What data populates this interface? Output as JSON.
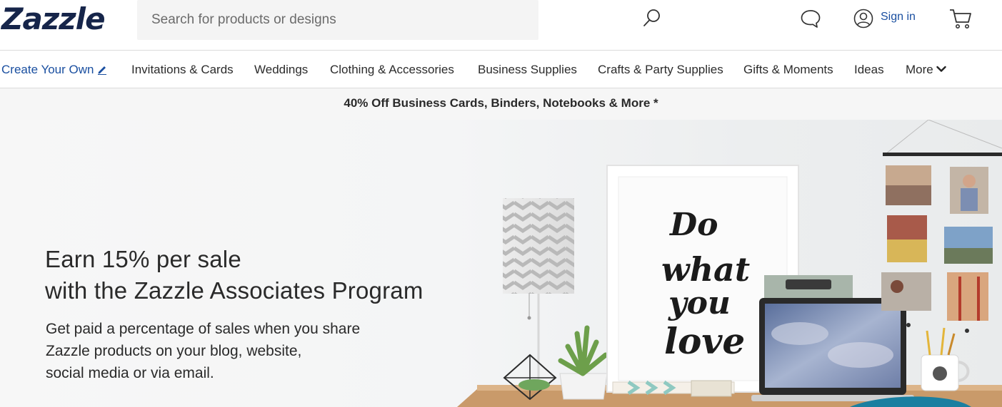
{
  "brand": {
    "logo_text": "Zazzle",
    "logo_color": "#16254a",
    "link_color": "#1a4fa0"
  },
  "search": {
    "placeholder": "Search for products or designs",
    "value": ""
  },
  "header": {
    "sign_in_label": "Sign in",
    "icons": [
      "search-icon",
      "chat-icon",
      "account-icon",
      "cart-icon"
    ]
  },
  "nav": {
    "items": [
      {
        "label": "Create Your Own"
      },
      {
        "label": "Invitations & Cards"
      },
      {
        "label": "Weddings"
      },
      {
        "label": "Clothing & Accessories"
      },
      {
        "label": "Business Supplies"
      },
      {
        "label": "Crafts & Party Supplies"
      },
      {
        "label": "Gifts & Moments"
      },
      {
        "label": "Ideas"
      },
      {
        "label": "More"
      }
    ]
  },
  "promo": {
    "text": "40% Off Business Cards, Binders, Notebooks & More *"
  },
  "hero": {
    "title_line1": "Earn 15% per sale",
    "title_line2": "with the Zazzle Associates Program",
    "body_line1": "Get paid a percentage of sales when you share",
    "body_line2": "Zazzle products on your blog, website,",
    "body_line3": "social media or via email.",
    "poster": {
      "line1": "Do",
      "line2": "what",
      "line3": "you",
      "line4": "love"
    }
  }
}
